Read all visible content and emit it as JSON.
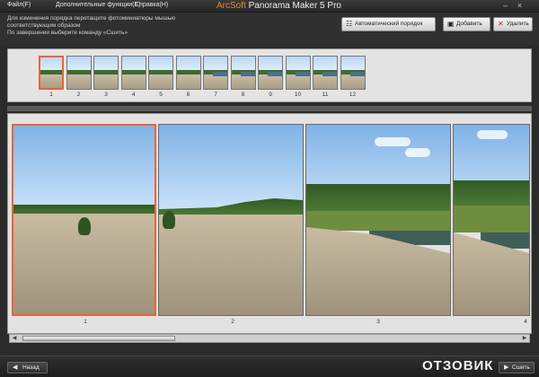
{
  "menu": {
    "file": "Файл(F)",
    "extra": "Дополнительные функции(E)",
    "help": "Справка(H)"
  },
  "app": {
    "brand": "ArcSoft",
    "title": "Panorama Maker 5 Pro"
  },
  "window": {
    "minimize": "–",
    "close": "×"
  },
  "instructions": {
    "line1": "Для изменения порядка перетащите фотоминиатюры мышью",
    "line2": "соответствующим образом",
    "line3": "По завершении выберите команду «Сшить»"
  },
  "toolbar": {
    "auto_order": "Автоматический порядок",
    "add": "Добавить",
    "delete": "Удалить"
  },
  "thumbnails": [
    "1",
    "2",
    "3",
    "4",
    "5",
    "6",
    "7",
    "8",
    "9",
    "10",
    "11",
    "12"
  ],
  "photos": [
    "1",
    "2",
    "3",
    "4"
  ],
  "bottom": {
    "back": "Назад",
    "stitch": "Сшить"
  },
  "watermark": "ОТЗОВИК",
  "colors": {
    "selection": "#e8643a",
    "brand": "#e08a3c"
  },
  "icons": {
    "auto_order": "auto-order-icon",
    "add": "add-icon",
    "delete": "delete-icon",
    "back": "back-arrow-icon",
    "stitch": "stitch-icon"
  }
}
